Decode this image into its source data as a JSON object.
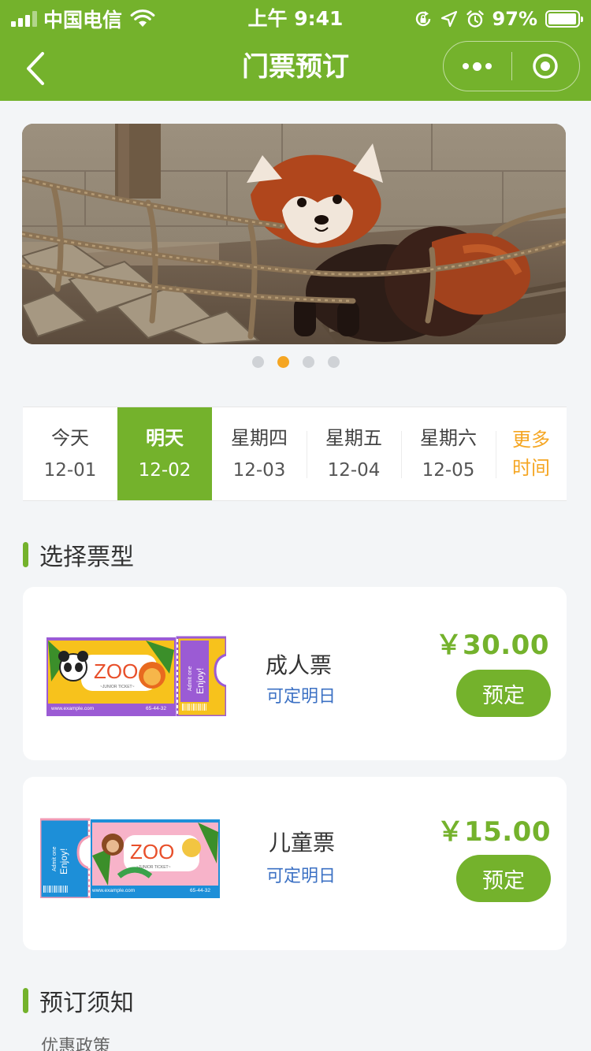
{
  "status_bar": {
    "carrier": "中国电信",
    "time": "上午 9:41",
    "battery": "97%",
    "battery_level": 0.97
  },
  "nav": {
    "title": "门票预订"
  },
  "banner": {
    "slide_count": 4,
    "active_slide": 2
  },
  "dates": [
    {
      "label": "今天",
      "date": "12-01",
      "selected": false
    },
    {
      "label": "明天",
      "date": "12-02",
      "selected": true
    },
    {
      "label": "星期四",
      "date": "12-03",
      "selected": false
    },
    {
      "label": "星期五",
      "date": "12-04",
      "selected": false
    },
    {
      "label": "星期六",
      "date": "12-05",
      "selected": false
    }
  ],
  "more_dates": "更多时间",
  "ticket_section": {
    "title": "选择票型"
  },
  "tickets": [
    {
      "name": "成人票",
      "note": "可定明日",
      "price": "￥30.00",
      "book_label": "预定",
      "image": {
        "text": "ZOO",
        "subtitle": "~JUNIOR TICKET~",
        "admit": "Admit one",
        "enjoy": "Enjoy!",
        "url": "www.example.com",
        "code": "65-44-32"
      }
    },
    {
      "name": "儿童票",
      "note": "可定明日",
      "price": "￥15.00",
      "book_label": "预定",
      "image": {
        "text": "ZOO",
        "subtitle": "~JUNIOR TICKET~",
        "admit": "Admit one",
        "enjoy": "Enjoy!",
        "url": "www.example.com",
        "code": "65-44-32"
      }
    }
  ],
  "notice_section": {
    "title": "预订须知",
    "subtitle": "优惠政策"
  },
  "colors": {
    "primary": "#74b22c",
    "accent": "#f5a623",
    "link": "#3c71c4",
    "background": "#f3f5f7"
  },
  "icons": [
    "signal-icon",
    "wifi-icon",
    "lock-rotation-icon",
    "location-icon",
    "alarm-icon",
    "battery-icon",
    "back-icon",
    "more-icon",
    "target-icon"
  ]
}
